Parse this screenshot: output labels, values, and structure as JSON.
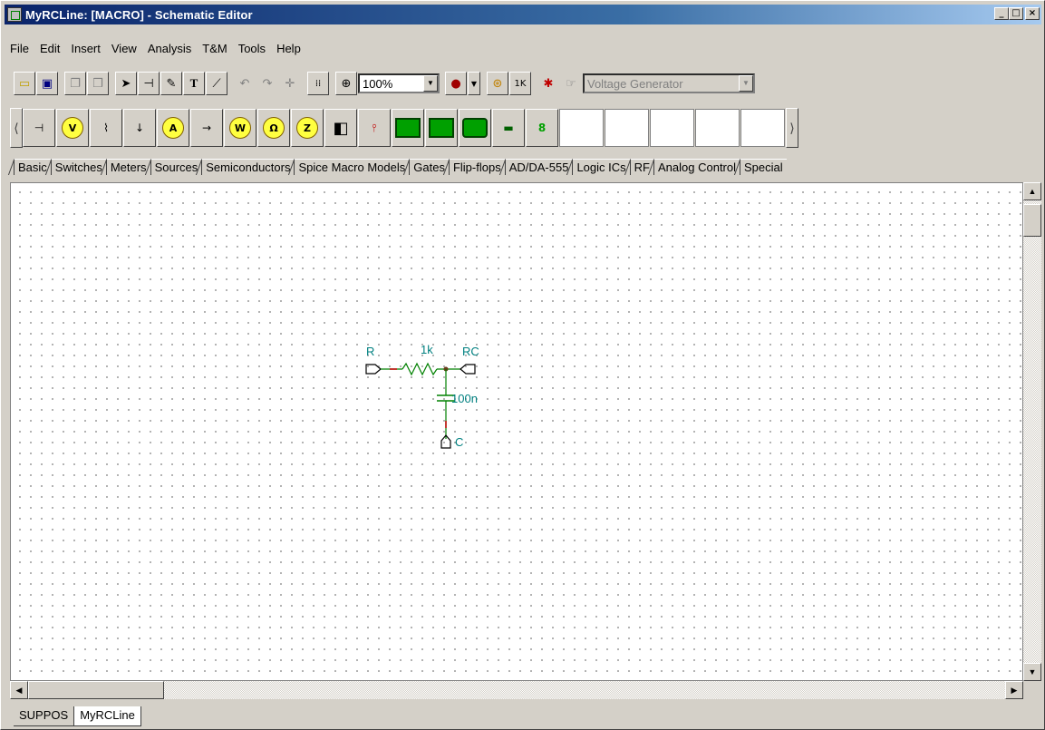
{
  "window": {
    "title": "MyRCLine: [MACRO] - Schematic Editor"
  },
  "menu": [
    "File",
    "Edit",
    "Insert",
    "View",
    "Analysis",
    "T&M",
    "Tools",
    "Help"
  ],
  "toolbar": {
    "zoom": "100%",
    "generator": "Voltage Generator"
  },
  "palette_tabs": [
    "Basic",
    "Switches",
    "Meters",
    "Sources",
    "Semiconductors",
    "Spice Macro Models",
    "Gates",
    "Flip-flops",
    "AD/DA-555",
    "Logic ICs",
    "RF",
    "Analog Control",
    "Special"
  ],
  "schematic": {
    "r_label": "R",
    "resistor_value": "1k",
    "rc_label": "RC",
    "cap_value": "100n",
    "c_label": "C"
  },
  "bottom_tabs": [
    "SUPPOS",
    "MyRCLine"
  ]
}
